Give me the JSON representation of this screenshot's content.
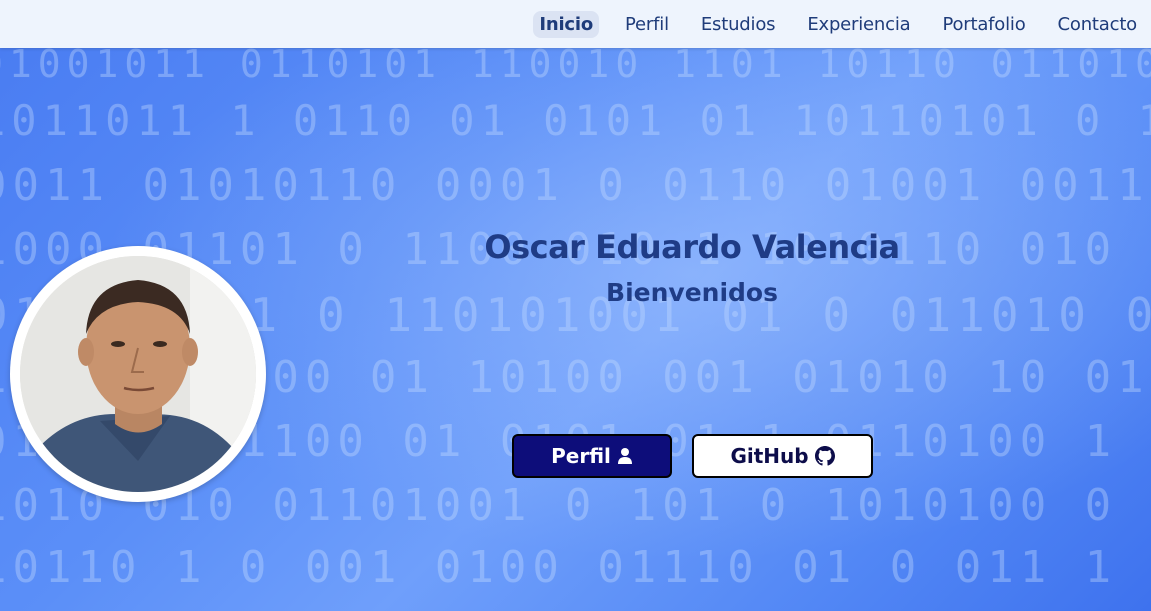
{
  "nav": {
    "items": [
      {
        "label": "Inicio",
        "active": true
      },
      {
        "label": "Perfil",
        "active": false
      },
      {
        "label": "Estudios",
        "active": false
      },
      {
        "label": "Experiencia",
        "active": false
      },
      {
        "label": "Portafolio",
        "active": false
      },
      {
        "label": "Contacto",
        "active": false
      }
    ]
  },
  "hero": {
    "title": "Oscar Eduardo Valencia",
    "subtitle": "Bienvenidos",
    "buttons": {
      "perfil": {
        "label": "Perfil",
        "icon": "user-icon"
      },
      "github": {
        "label": "GitHub",
        "icon": "github-icon"
      }
    }
  },
  "colors": {
    "nav_bg": "#eef4fd",
    "nav_text": "#1f3c7a",
    "title": "#1f3c86",
    "perfil_button": "#0d0d7a",
    "hero_bg": "#5b8ff8"
  }
}
